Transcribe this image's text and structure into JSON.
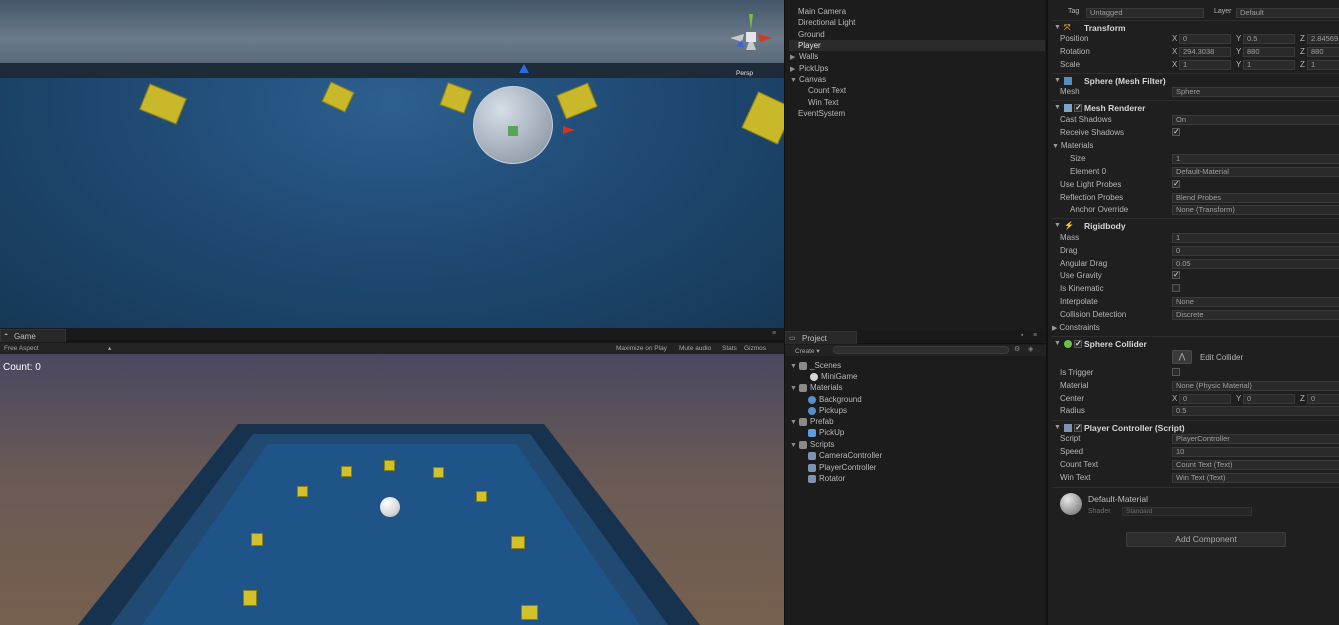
{
  "scene": {
    "gizmo_label": "Persp"
  },
  "game": {
    "tab_label": "Game",
    "aspect_label": "Free Aspect",
    "toolbar": [
      "Maximize on Play",
      "Mute audio",
      "Stats",
      "Gizmos"
    ],
    "count_text": "Count: 0"
  },
  "hierarchy": {
    "items": [
      {
        "label": "Main Camera",
        "arrow": "",
        "indent": 0
      },
      {
        "label": "Directional Light",
        "arrow": "",
        "indent": 0
      },
      {
        "label": "Ground",
        "arrow": "",
        "indent": 0
      },
      {
        "label": "Player",
        "arrow": "",
        "indent": 0,
        "selected": true
      },
      {
        "label": "Walls",
        "arrow": "▶",
        "indent": 0
      },
      {
        "label": "PickUps",
        "arrow": "▶",
        "indent": 0
      },
      {
        "label": "Canvas",
        "arrow": "▼",
        "indent": 0
      },
      {
        "label": "Count Text",
        "arrow": "",
        "indent": 1
      },
      {
        "label": "Win Text",
        "arrow": "",
        "indent": 1
      },
      {
        "label": "EventSystem",
        "arrow": "",
        "indent": 0
      }
    ]
  },
  "project": {
    "tab_label": "Project",
    "create_label": "Create ▾",
    "items": [
      {
        "label": "_Scenes",
        "arrow": "▼",
        "indent": 0,
        "icon": "folder"
      },
      {
        "label": "MiniGame",
        "arrow": "",
        "indent": 1,
        "icon": "unity"
      },
      {
        "label": "Materials",
        "arrow": "▼",
        "indent": 0,
        "icon": "folder"
      },
      {
        "label": "Background",
        "arrow": "",
        "indent": 1,
        "icon": "material"
      },
      {
        "label": "Pickups",
        "arrow": "",
        "indent": 1,
        "icon": "material"
      },
      {
        "label": "Prefab",
        "arrow": "▼",
        "indent": 0,
        "icon": "folder"
      },
      {
        "label": "PickUp",
        "arrow": "",
        "indent": 1,
        "icon": "prefab"
      },
      {
        "label": "Scripts",
        "arrow": "▼",
        "indent": 0,
        "icon": "folder"
      },
      {
        "label": "CameraController",
        "arrow": "",
        "indent": 1,
        "icon": "script"
      },
      {
        "label": "PlayerController",
        "arrow": "",
        "indent": 1,
        "icon": "script"
      },
      {
        "label": "Rotator",
        "arrow": "",
        "indent": 1,
        "icon": "script"
      }
    ]
  },
  "inspector": {
    "tag_label": "Tag",
    "tag_value": "Untagged",
    "layer_label": "Layer",
    "layer_value": "Default",
    "transform": {
      "title": "Transform",
      "position_label": "Position",
      "rotation_label": "Rotation",
      "scale_label": "Scale",
      "position": {
        "x": "0",
        "y": "0.5",
        "z": "2.84569"
      },
      "rotation": {
        "x": "294.3038",
        "y": "880",
        "z": "880"
      },
      "scale": {
        "x": "1",
        "y": "1",
        "z": "1"
      }
    },
    "mesh_filter": {
      "title": "Sphere (Mesh Filter)",
      "mesh_label": "Mesh",
      "mesh_value": "Sphere"
    },
    "mesh_renderer": {
      "title": "Mesh Renderer",
      "cast_shadows_label": "Cast Shadows",
      "cast_shadows_value": "On",
      "receive_shadows_label": "Receive Shadows",
      "materials_label": "Materials",
      "size_label": "Size",
      "size_value": "1",
      "element0_label": "Element 0",
      "element0_value": "Default-Material",
      "light_probes_label": "Use Light Probes",
      "reflection_probes_label": "Reflection Probes",
      "reflection_probes_value": "Blend Probes",
      "anchor_override_label": "Anchor Override",
      "anchor_override_value": "None (Transform)"
    },
    "rigidbody": {
      "title": "Rigidbody",
      "mass_label": "Mass",
      "mass_value": "1",
      "drag_label": "Drag",
      "drag_value": "0",
      "angular_drag_label": "Angular Drag",
      "angular_drag_value": "0.05",
      "use_gravity_label": "Use Gravity",
      "is_kinematic_label": "Is Kinematic",
      "interpolate_label": "Interpolate",
      "interpolate_value": "None",
      "collision_label": "Collision Detection",
      "collision_value": "Discrete",
      "constraints_label": "Constraints"
    },
    "sphere_collider": {
      "title": "Sphere Collider",
      "edit_collider_label": "Edit Collider",
      "is_trigger_label": "Is Trigger",
      "material_label": "Material",
      "material_value": "None (Physic Material)",
      "center_label": "Center",
      "center": {
        "x": "0",
        "y": "0",
        "z": "0"
      },
      "radius_label": "Radius",
      "radius_value": "0.5"
    },
    "player_controller": {
      "title": "Player Controller (Script)",
      "script_label": "Script",
      "script_value": "PlayerController",
      "speed_label": "Speed",
      "speed_value": "10",
      "count_text_label": "Count Text",
      "count_text_value": "Count Text (Text)",
      "win_text_label": "Win Text",
      "win_text_value": "Win Text (Text)"
    },
    "material": {
      "name": "Default-Material",
      "shader_label": "Shader",
      "shader_value": "Standard"
    },
    "add_component_label": "Add Component"
  }
}
